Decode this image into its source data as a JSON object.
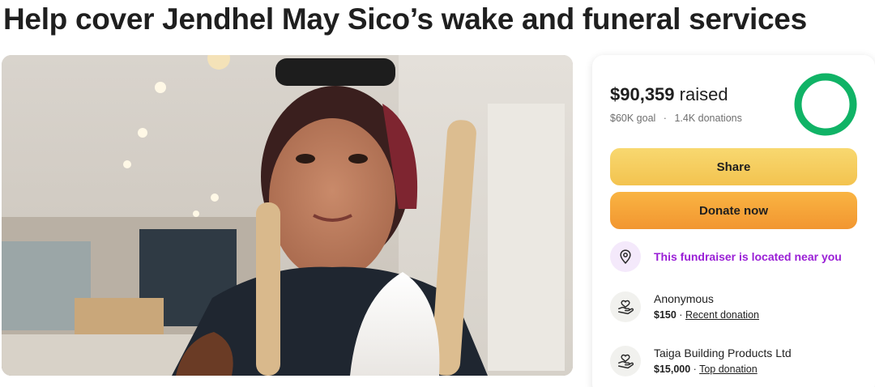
{
  "page": {
    "title": "Help cover Jendhel May Sico’s wake and funeral services"
  },
  "summary": {
    "raised_amount": "$90,359",
    "raised_suffix": "raised",
    "goal": "$60K goal",
    "separator": "·",
    "donations": "1.4K donations",
    "progress_fraction": 1.0
  },
  "actions": {
    "share_label": "Share",
    "donate_label": "Donate now"
  },
  "location_notice": {
    "text": "This fundraiser is located near you",
    "icon": "location-pin-icon"
  },
  "donations": [
    {
      "name": "Anonymous",
      "amount": "$150",
      "separator": "·",
      "label": "Recent donation",
      "icon": "heart-hand-icon"
    },
    {
      "name": "Taiga Building Products Ltd",
      "amount": "$15,000",
      "separator": "·",
      "label": "Top donation",
      "icon": "heart-hand-icon"
    }
  ],
  "colors": {
    "progress": "#10b366",
    "share_button": "#f5c95a",
    "donate_button": "#f4a43a",
    "location_text": "#9a1fd6"
  }
}
